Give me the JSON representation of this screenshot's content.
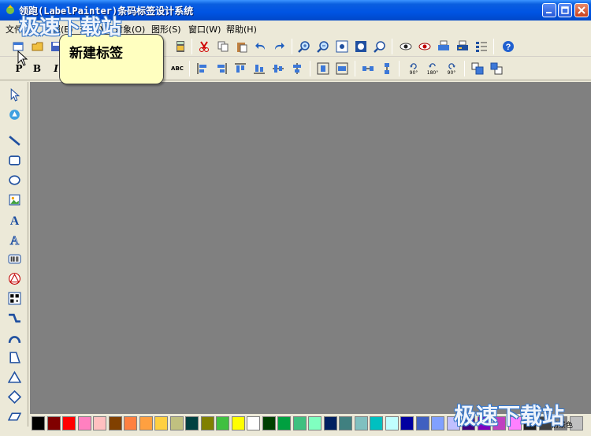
{
  "window": {
    "title": "领跑(LabelPainter)条码标签设计系统"
  },
  "menu": {
    "items": [
      "文件(F)",
      "编辑(E)",
      "查看(V)",
      "对象(O)",
      "图形(S)",
      "窗口(W)",
      "帮助(H)"
    ]
  },
  "toolbar2": {
    "bold_p": "P",
    "bold_b": "B",
    "italic_i": "I",
    "abc": "ABC",
    "rot90": "90°",
    "rot180": "180°",
    "rot90b": "90°"
  },
  "tooltip": {
    "text": "新建标签"
  },
  "palette": {
    "colors": [
      "#000000",
      "#800000",
      "#ff0000",
      "#ff80c0",
      "#ffc0c0",
      "#804000",
      "#ff8040",
      "#ffa040",
      "#ffd040",
      "#c0c080",
      "#004040",
      "#808000",
      "#40c040",
      "#ffff00",
      "#ffffff",
      "#004000",
      "#00a040",
      "#40c080",
      "#80ffc0",
      "#002060",
      "#408080",
      "#80c0c0",
      "#00c0c0",
      "#c0ffff",
      "#0000a0",
      "#4060c0",
      "#80a0ff",
      "#c0c0ff",
      "#400080",
      "#8000c0",
      "#c040c0",
      "#ff80ff",
      "#202020",
      "#404040",
      "#808080",
      "#c0c0c0"
    ],
    "fg_label": "前景色"
  },
  "watermark": {
    "top": "极速下载站",
    "bottom": "极速下载站"
  }
}
